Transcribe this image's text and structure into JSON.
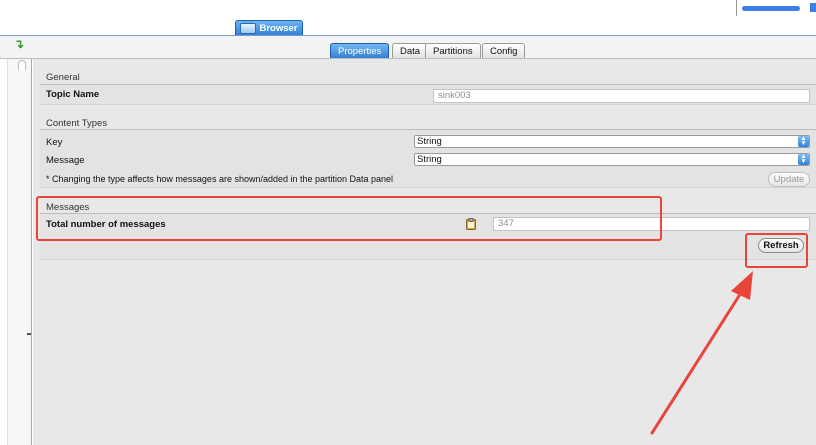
{
  "top": {
    "browser_tab": "Browser"
  },
  "tabs": [
    {
      "label": "Properties",
      "active": true
    },
    {
      "label": "Data",
      "active": false
    },
    {
      "label": "Partitions",
      "active": false
    },
    {
      "label": "Config",
      "active": false
    }
  ],
  "general": {
    "section_title": "General",
    "topic_name_label": "Topic Name",
    "topic_name_value": "sink003"
  },
  "content_types": {
    "section_title": "Content Types",
    "key_label": "Key",
    "key_value": "String",
    "message_label": "Message",
    "message_value": "String",
    "note": "* Changing the type affects how messages are shown/added in the partition Data panel",
    "update_button": "Update"
  },
  "messages": {
    "section_title": "Messages",
    "total_label": "Total number of messages",
    "total_value": "347",
    "refresh_button": "Refresh"
  },
  "colors": {
    "accent": "#2e7dd4",
    "annotation": "#e8443a"
  }
}
